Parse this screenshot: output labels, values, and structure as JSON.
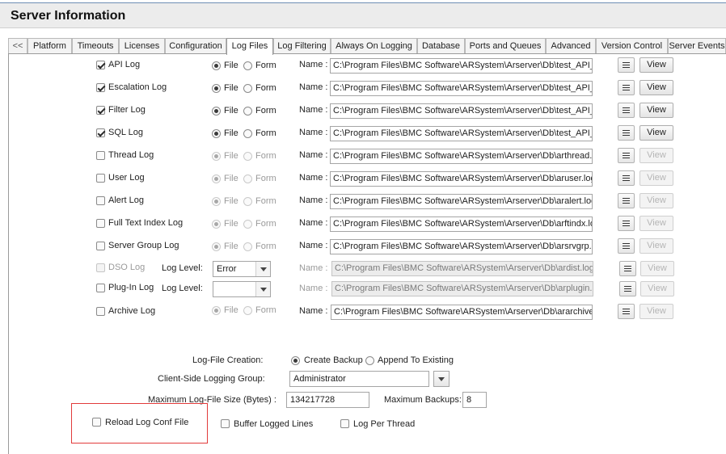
{
  "header": {
    "title": "Server Information"
  },
  "tabs": [
    {
      "label": "<<"
    },
    {
      "label": "Platform"
    },
    {
      "label": "Timeouts"
    },
    {
      "label": "Licenses"
    },
    {
      "label": "Configuration"
    },
    {
      "label": "Log Files",
      "active": true
    },
    {
      "label": "Log Filtering"
    },
    {
      "label": "Always On Logging"
    },
    {
      "label": "Database"
    },
    {
      "label": "Ports and Queues"
    },
    {
      "label": "Advanced"
    },
    {
      "label": "Version Control"
    },
    {
      "label": "Server Events"
    }
  ],
  "labels": {
    "file": "File",
    "form": "Form",
    "name": "Name :",
    "view": "View",
    "log_level": "Log Level:"
  },
  "logs": [
    {
      "label": "API Log",
      "checked": true,
      "mode": "file",
      "path": "C:\\Program Files\\BMC Software\\ARSystem\\Arserver\\Db\\test_API_F"
    },
    {
      "label": "Escalation Log",
      "checked": true,
      "mode": "file",
      "path": "C:\\Program Files\\BMC Software\\ARSystem\\Arserver\\Db\\test_API_F"
    },
    {
      "label": "Filter Log",
      "checked": true,
      "mode": "file",
      "path": "C:\\Program Files\\BMC Software\\ARSystem\\Arserver\\Db\\test_API_F"
    },
    {
      "label": "SQL Log",
      "checked": true,
      "mode": "file",
      "path": "C:\\Program Files\\BMC Software\\ARSystem\\Arserver\\Db\\test_API_F"
    },
    {
      "label": "Thread Log",
      "checked": false,
      "mode": "file",
      "path": "C:\\Program Files\\BMC Software\\ARSystem\\Arserver\\Db\\arthread.log"
    },
    {
      "label": "User Log",
      "checked": false,
      "mode": "file",
      "path": "C:\\Program Files\\BMC Software\\ARSystem\\Arserver\\Db\\aruser.log"
    },
    {
      "label": "Alert Log",
      "checked": false,
      "mode": "file",
      "path": "C:\\Program Files\\BMC Software\\ARSystem\\Arserver\\Db\\aralert.log"
    },
    {
      "label": "Full Text Index Log",
      "checked": false,
      "mode": "file",
      "path": "C:\\Program Files\\BMC Software\\ARSystem\\Arserver\\Db\\arftindx.log"
    },
    {
      "label": "Server Group Log",
      "checked": false,
      "mode": "file",
      "path": "C:\\Program Files\\BMC Software\\ARSystem\\Arserver\\Db\\arsrvgrp.log"
    }
  ],
  "dso_log": {
    "label": "DSO Log",
    "level": "Error",
    "path": "C:\\Program Files\\BMC Software\\ARSystem\\Arserver\\Db\\ardist.log"
  },
  "plugin_log": {
    "label": "Plug-In Log",
    "level": "",
    "path": "C:\\Program Files\\BMC Software\\ARSystem\\Arserver\\Db\\arplugin.log"
  },
  "archive_log": {
    "label": "Archive Log",
    "checked": false,
    "path": "C:\\Program Files\\BMC Software\\ARSystem\\Arserver\\Db\\ararchive.log"
  },
  "settings": {
    "creation_label": "Log-File Creation:",
    "create_backup": "Create Backup",
    "append": "Append To Existing",
    "group_label": "Client-Side Logging Group:",
    "group_value": "Administrator",
    "max_size_label": "Maximum Log-File Size (Bytes) :",
    "max_size_value": "134217728",
    "max_backups_label": "Maximum Backups:",
    "max_backups_value": "8"
  },
  "options": {
    "reload": "Reload Log Conf File",
    "buffer": "Buffer Logged Lines",
    "per_thread": "Log Per Thread"
  },
  "colors": {
    "highlight": "#e23b3b"
  }
}
